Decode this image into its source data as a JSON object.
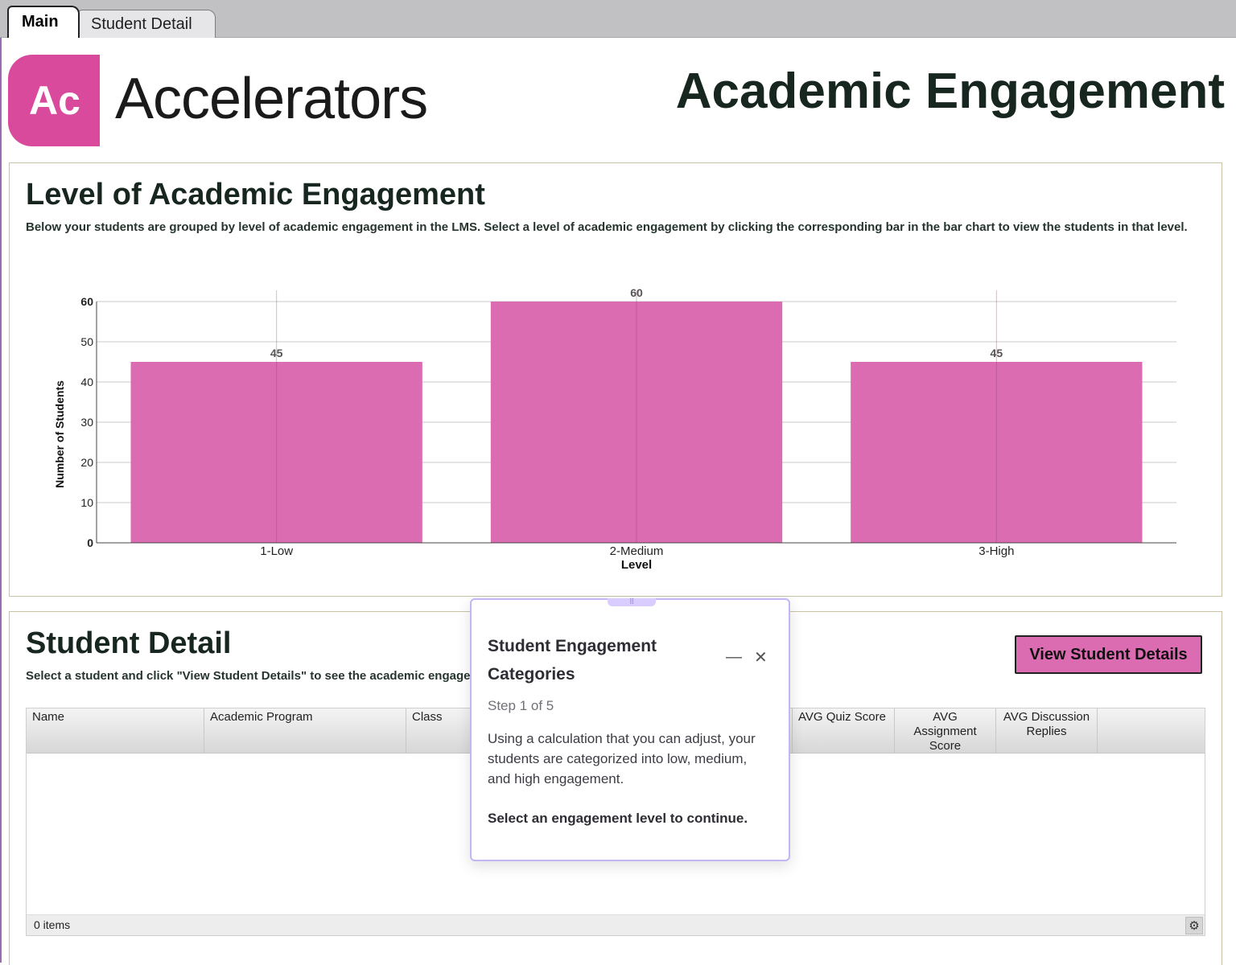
{
  "tabs": [
    {
      "label": "Main",
      "active": true
    },
    {
      "label": "Student Detail",
      "active": false
    }
  ],
  "logo": {
    "mark": "Ac",
    "brand": "Accelerators",
    "color": "#d94a9c"
  },
  "page_title": "Academic Engagement",
  "engagement_panel": {
    "title": "Level of Academic Engagement",
    "subtitle": "Below your students are grouped by level of academic engagement in the LMS. Select a level of academic engagement by clicking the corresponding bar in the bar chart to view the students in that level."
  },
  "chart_data": {
    "type": "bar",
    "categories": [
      "1-Low",
      "2-Medium",
      "3-High"
    ],
    "values": [
      45,
      60,
      45
    ],
    "xlabel": "Level",
    "ylabel": "Number of Students",
    "ylim": [
      0,
      60
    ],
    "yticks": [
      0,
      10,
      20,
      30,
      40,
      50,
      60
    ],
    "bar_color": "#dc6cb1",
    "grid": true
  },
  "student_panel": {
    "title": "Student Detail",
    "subtitle": "Select a student and click \"View Student Details\" to see the academic engagement",
    "view_button": "View Student Details",
    "columns": [
      "Name",
      "Academic Program",
      "Class",
      "",
      "AVG Quiz Score",
      "AVG Assignment Score",
      "AVG Discussion Replies"
    ],
    "footer": "0 items",
    "settings_icon": "gear-icon"
  },
  "popover": {
    "title": "Student Engagement Categories",
    "step": "Step 1 of 5",
    "body": "Using a calculation that you can adjust, your students are categorized into low, medium, and high engagement.",
    "cta": "Select an engagement level to continue.",
    "accent": "#c4b5f4"
  }
}
